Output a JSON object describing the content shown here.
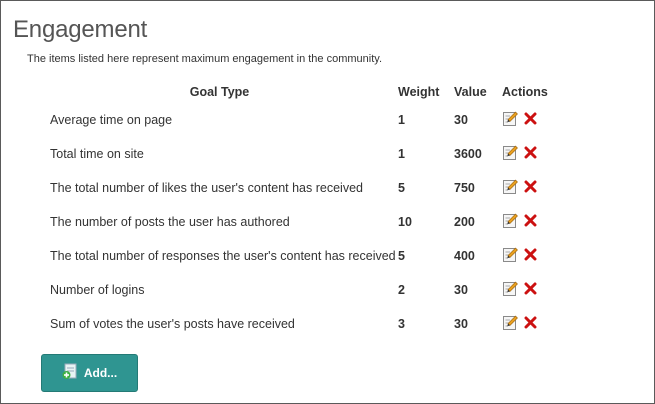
{
  "page": {
    "title": "Engagement",
    "description": "The items listed here represent maximum engagement in the community."
  },
  "table": {
    "headers": {
      "goal_type": "Goal Type",
      "weight": "Weight",
      "value": "Value",
      "actions": "Actions"
    },
    "rows": [
      {
        "goal_type": "Average time on page",
        "weight": "1",
        "value": "30"
      },
      {
        "goal_type": "Total time on site",
        "weight": "1",
        "value": "3600"
      },
      {
        "goal_type": "The total number of likes the user's content has received",
        "weight": "5",
        "value": "750"
      },
      {
        "goal_type": "The number of posts the user has authored",
        "weight": "10",
        "value": "200"
      },
      {
        "goal_type": "The total number of responses the user's content has received",
        "weight": "5",
        "value": "400"
      },
      {
        "goal_type": "Number of logins",
        "weight": "2",
        "value": "30"
      },
      {
        "goal_type": "Sum of votes the user's posts have received",
        "weight": "3",
        "value": "30"
      }
    ],
    "row_actions": {
      "edit_icon": "edit-pencil-icon",
      "delete_icon": "delete-x-icon"
    }
  },
  "add_button": {
    "label": "Add...",
    "icon": "add-document-icon"
  },
  "colors": {
    "add_button_bg": "#2f9591",
    "delete_red": "#cc1111",
    "edit_orange": "#e8a020"
  }
}
